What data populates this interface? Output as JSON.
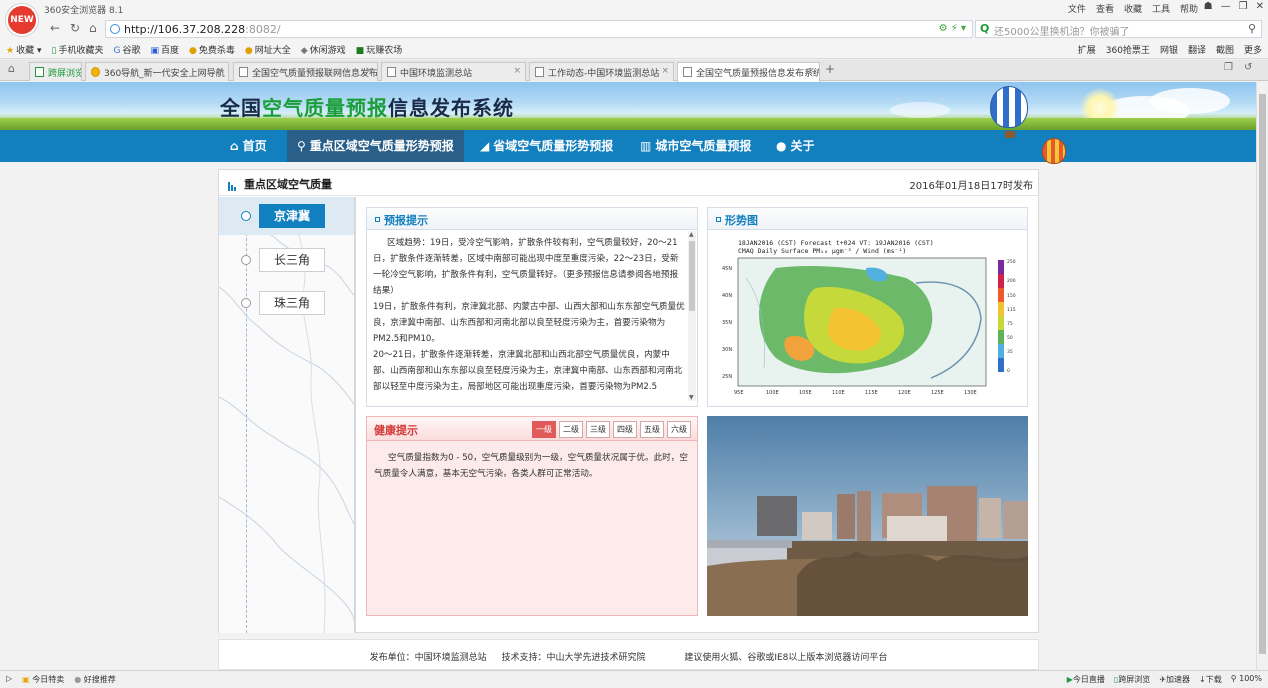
{
  "browser": {
    "app_title": "360安全浏览器 8.1",
    "logo": "NEW",
    "menus": [
      "文件",
      "查看",
      "收藏",
      "工具",
      "帮助"
    ],
    "url_host": "http://106.37.208.228",
    "url_port": ":8082/",
    "search_placeholder": "还5000公里换机油？你被骗了",
    "favorites": [
      "收藏",
      "手机收藏夹",
      "谷歌",
      "百度",
      "免费杀毒",
      "网址大全",
      "休闲游戏",
      "玩赚农场"
    ],
    "fav_right": [
      "扩展",
      "360抢票王",
      "网银",
      "翻译",
      "截图",
      "更多"
    ],
    "tabs": [
      {
        "label": "跨屏浏览"
      },
      {
        "label": "360导航_新一代安全上网导航"
      },
      {
        "label": "全国空气质量预报联网信息发布"
      },
      {
        "label": "中国环境监测总站"
      },
      {
        "label": "工作动态-中国环境监测总站"
      },
      {
        "label": "全国空气质量预报信息发布系统"
      }
    ],
    "status_left": [
      "今日特卖",
      "好搜推荐"
    ],
    "status_right": [
      "今日直播",
      "跨屏浏览",
      "加速器",
      "下载",
      "100%"
    ]
  },
  "site": {
    "title_parts": [
      "全国",
      "空气质量预报",
      "信息发布系统"
    ],
    "nav": [
      {
        "label": "首页",
        "icon": "home-icon"
      },
      {
        "label": "重点区域空气质量形势预报",
        "icon": "map-marker-icon"
      },
      {
        "label": "省域空气质量形势预报",
        "icon": "area-chart-icon"
      },
      {
        "label": "城市空气质量预报",
        "icon": "bar-chart-icon"
      },
      {
        "label": "关于",
        "icon": "info-icon"
      }
    ]
  },
  "main": {
    "heading": "重点区域空气质量",
    "timestamp": "2016年01月18日17时发布",
    "regions": [
      "京津冀",
      "长三角",
      "珠三角"
    ],
    "forecast_title": "预报提示",
    "forecast_paragraphs": [
      "区域趋势：19日，受冷空气影响，扩散条件较有利，空气质量较好，20～21日，扩散条件逐渐转差，区域中南部可能出现中度至重度污染，22～23日，受新一轮冷空气影响，扩散条件有利，空气质量转好。（更多预报信息请参阅各地预报结果）",
      "19日，扩散条件有利，京津冀北部、内蒙古中部、山西大部和山东东部空气质量优良，京津冀中南部、山东西部和河南北部以良至轻度污染为主，首要污染物为PM2.5和PM10。",
      "20～21日，扩散条件逐渐转差，京津冀北部和山西北部空气质量优良，内蒙中部、山西南部和山东东部以良至轻度污染为主，京津冀中南部、山东西部和河南北部以轻至中度污染为主，局部地区可能出现重度污染，首要污染物为PM2.5"
    ],
    "map_title": "形势图",
    "map_caption_line1": "18JAN2016 (CST) Forecast t+024 VT: 19JAN2016 (CST)",
    "map_caption_line2": "CMAQ Daily Surface PM₁₀ μgm⁻³ / Wind (ms⁻¹)",
    "map_lat_ticks": [
      "45N",
      "40N",
      "35N",
      "30N",
      "25N"
    ],
    "map_lon_ticks": [
      "95E",
      "100E",
      "105E",
      "110E",
      "115E",
      "120E",
      "125E",
      "130E"
    ],
    "map_colorbar_ticks": [
      "250",
      "200",
      "150",
      "115",
      "75",
      "50",
      "35",
      "0"
    ],
    "health_title": "健康提示",
    "levels": [
      "一级",
      "二级",
      "三级",
      "四级",
      "五级",
      "六级"
    ],
    "active_level": 0,
    "health_text": "空气质量指数为0 - 50，空气质量级别为一级，空气质量状况属于优。此时，空气质量令人满意，基本无空气污染，各类人群可正常活动。"
  },
  "footer": {
    "publisher": "发布单位：中国环境监测总站",
    "support": "技术支持：中山大学先进技术研究院",
    "advice": "建议使用火狐、谷歌或IE8以上版本浏览器访问平台"
  },
  "colors": {
    "nav_blue": "#127fbf",
    "nav_active": "#2a5f8a",
    "title_green": "#1b9e3a",
    "health_red": "#d43a3a"
  }
}
